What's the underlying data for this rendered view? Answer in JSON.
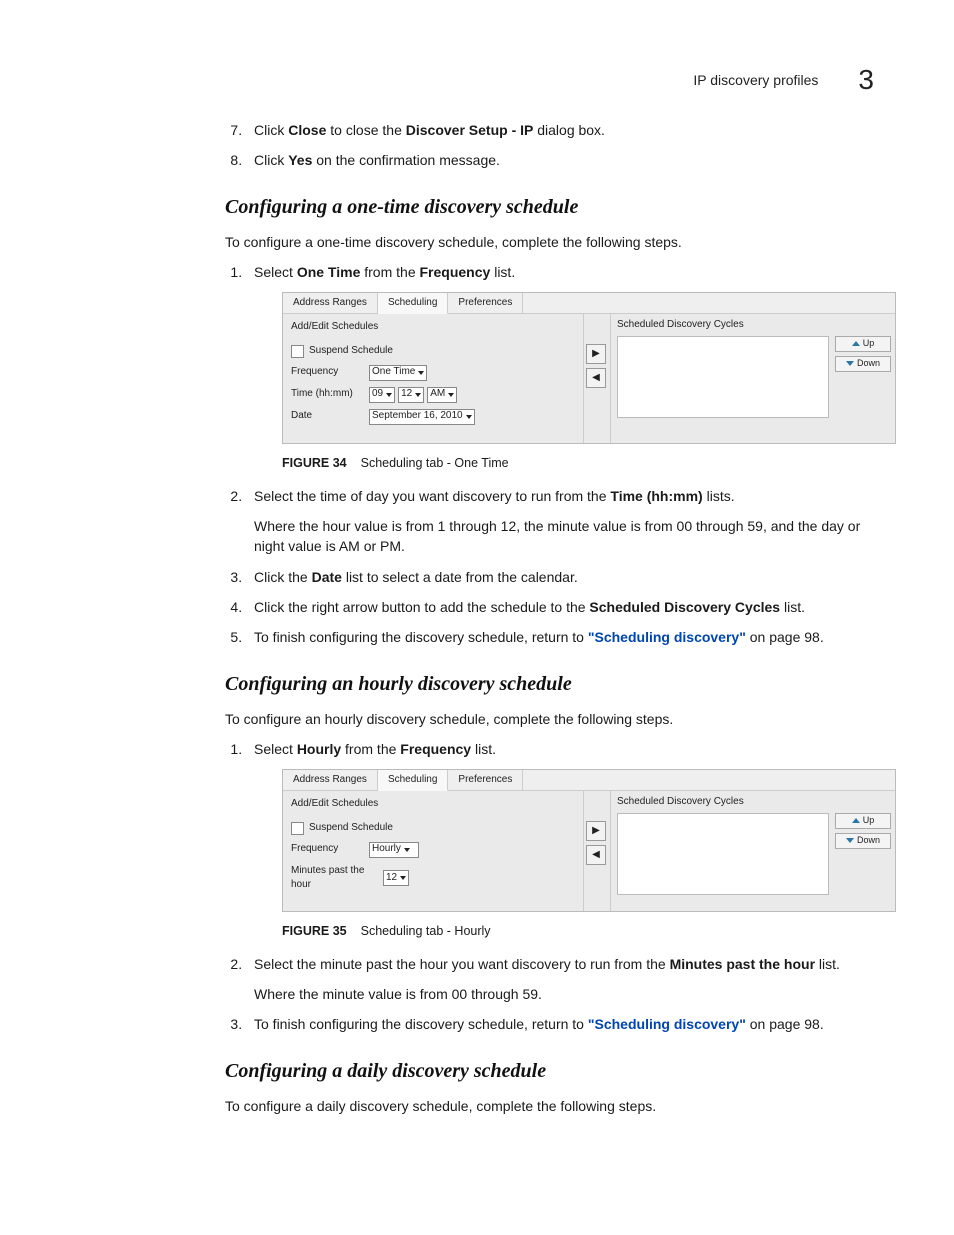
{
  "header": {
    "title": "IP discovery profiles",
    "chapter_num": "3"
  },
  "opening_steps": [
    {
      "num": "7.",
      "pre": "Click ",
      "b1": "Close",
      "mid1": " to close the ",
      "b2": "Discover Setup - IP",
      "post": " dialog box."
    },
    {
      "num": "8.",
      "pre": "Click ",
      "b1": "Yes",
      "mid1": " on the confirmation message.",
      "b2": "",
      "post": ""
    }
  ],
  "section1": {
    "title": "Configuring a one-time discovery schedule",
    "intro": "To configure a one-time discovery schedule, complete the following steps.",
    "step1": {
      "pre": "Select ",
      "b1": "One Time",
      "mid": " from the ",
      "b2": "Frequency",
      "post": " list."
    },
    "step2": {
      "pre": "Select the time of day you want discovery to run from the ",
      "b1": "Time (hh:mm)",
      "post": " lists.",
      "sub": "Where the hour value is from 1 through 12, the minute value is from 00 through 59, and the day or night value is AM or PM."
    },
    "step3": {
      "pre": "Click the ",
      "b1": "Date",
      "post": " list to select a date from the calendar."
    },
    "step4": {
      "pre": "Click the right arrow button to add the schedule to the ",
      "b1": "Scheduled Discovery Cycles",
      "post": " list."
    },
    "step5": {
      "pre": "To finish configuring the discovery schedule, return to ",
      "link": "\"Scheduling discovery\"",
      "post": " on page 98."
    }
  },
  "section2": {
    "title": "Configuring an hourly discovery schedule",
    "intro": "To configure an hourly discovery schedule, complete the following steps.",
    "step1": {
      "pre": "Select ",
      "b1": "Hourly",
      "mid": " from the ",
      "b2": "Frequency",
      "post": " list."
    },
    "step2": {
      "pre": "Select the minute past the hour you want discovery to run from the ",
      "b1": "Minutes past the hour",
      "post": " list.",
      "sub": "Where the minute value is from 00 through 59."
    },
    "step3": {
      "pre": "To finish configuring the discovery schedule, return to ",
      "link": "\"Scheduling discovery\"",
      "post": " on page 98."
    }
  },
  "section3": {
    "title": "Configuring a daily discovery schedule",
    "intro": "To configure a daily discovery schedule, complete the following steps."
  },
  "figures": {
    "fig34": {
      "label": "FIGURE 34",
      "caption": "Scheduling tab - One Time"
    },
    "fig35": {
      "label": "FIGURE 35",
      "caption": "Scheduling tab - Hourly"
    }
  },
  "panel_common": {
    "tabs": [
      "Address Ranges",
      "Scheduling",
      "Preferences"
    ],
    "left_header": "Add/Edit Schedules",
    "right_header": "Scheduled Discovery Cycles",
    "suspend": "Suspend Schedule",
    "freq_label": "Frequency",
    "up": "Up",
    "down": "Down"
  },
  "panel1": {
    "freq_value": "One Time",
    "time_label": "Time (hh:mm)",
    "time_hh": "09",
    "time_mm": "12",
    "time_ampm": "AM",
    "date_label": "Date",
    "date_value": "September 16, 2010"
  },
  "panel2": {
    "freq_value": "Hourly",
    "min_label": "Minutes past the hour",
    "min_value": "12"
  }
}
